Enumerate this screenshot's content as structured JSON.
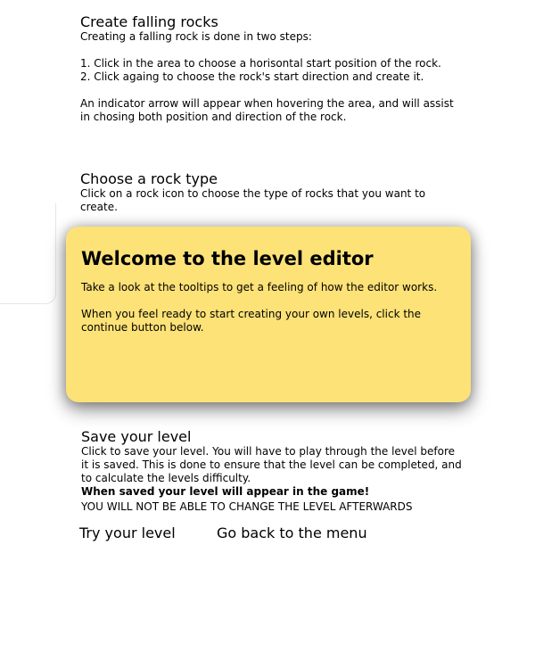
{
  "falling_rocks": {
    "heading": "Create falling rocks",
    "body": "Creating a falling rock is done in two steps:\n\n1. Click in the area to choose a horisontal start position of the rock.\n2. Click againg to choose the rock's start direction and create it.\n\nAn indicator arrow will appear when hovering the area, and will assist in chosing both position and direction of the rock."
  },
  "rock_type": {
    "heading": "Choose a rock type",
    "body": "Click on a rock icon to choose the type of rocks that you want to create."
  },
  "welcome_popup": {
    "title": "Welcome to the level editor",
    "body": "Take a look at the tooltips to get a feeling of how the editor works.\n\nWhen you feel ready to start creating your own levels, click the continue button below.",
    "background_color": "#fde277"
  },
  "save_level": {
    "heading": "Save your level",
    "body": "Click to save your level. You will have to play through the level before it is saved. This is done to ensure that the level can be completed, and to calculate the levels difficulty.",
    "bold_note": "When saved your level will appear in the game!",
    "warning": "YOU WILL NOT BE ABLE TO CHANGE THE LEVEL AFTERWARDS"
  },
  "actions": {
    "try_level": "Try your level",
    "back_to_menu": "Go back to the menu"
  }
}
